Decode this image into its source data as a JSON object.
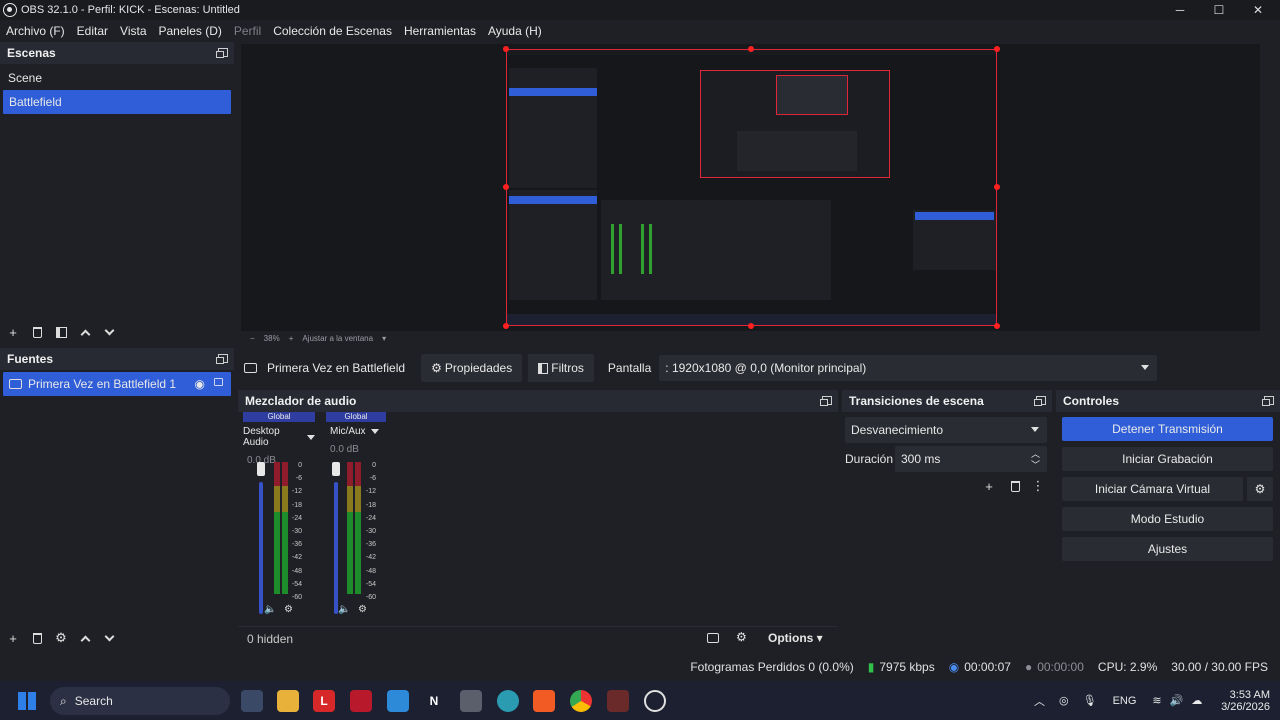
{
  "window": {
    "title": "OBS 32.1.0 - Perfil: KICK - Escenas: Untitled",
    "minimize": "─",
    "maximize": "☐",
    "close": "✕"
  },
  "menu": {
    "items": [
      "Archivo (F)",
      "Editar",
      "Vista",
      "Paneles (D)",
      "Perfil",
      "Colección de Escenas",
      "Herramientas",
      "Ayuda (H)"
    ]
  },
  "scenes": {
    "title": "Escenas",
    "items": [
      "Scene",
      "Battlefield"
    ],
    "selected": "Battlefield"
  },
  "sources": {
    "title": "Fuentes",
    "items": [
      "Primera Vez en Battlefield 1"
    ]
  },
  "preview": {
    "zoom": "38%",
    "fit_label": "Ajustar a la ventana",
    "minus": "−",
    "plus": "+"
  },
  "context": {
    "source_name": "Primera Vez en Battlefield",
    "properties": "Propiedades",
    "filters": "Filtros",
    "display_label": "Pantalla",
    "display_value": ": 1920x1080 @ 0,0 (Monitor principal)"
  },
  "mixer": {
    "title": "Mezclador de audio",
    "channels": [
      {
        "header": "Global",
        "name": "Desktop Audio",
        "db": "0.0 dB",
        "level": 1.0
      },
      {
        "header": "Global",
        "name": "Mic/Aux",
        "db": "0.0 dB",
        "level": 1.0
      }
    ],
    "scale": [
      "0",
      "-6",
      "-12",
      "-18",
      "-24",
      "-30",
      "-36",
      "-42",
      "-48",
      "-54",
      "-60"
    ],
    "hidden": "0 hidden",
    "options": "Options"
  },
  "transitions": {
    "title": "Transiciones de escena",
    "selected": "Desvanecimiento",
    "duration_label": "Duración",
    "duration_value": "300 ms"
  },
  "controls": {
    "title": "Controles",
    "stop_stream": "Detener Transmisión",
    "start_recording": "Iniciar Grabación",
    "virtual_camera": "Iniciar Cámara Virtual",
    "studio_mode": "Modo Estudio",
    "settings": "Ajustes"
  },
  "status": {
    "dropped_frames": "Fotogramas Perdidos 0 (0.0%)",
    "bitrate": "7975 kbps",
    "stream_time": "00:00:07",
    "record_time": "00:00:00",
    "cpu": "CPU: 2.9%",
    "fps": "30.00 / 30.00 FPS"
  },
  "taskbar": {
    "search": "Search",
    "lang": "ENG",
    "time": "3:53 AM",
    "date": "3/26/2026"
  },
  "colors": {
    "accent": "#2f5ed8",
    "preview_border": "#e0253a",
    "panel_bg": "#1f2025"
  }
}
